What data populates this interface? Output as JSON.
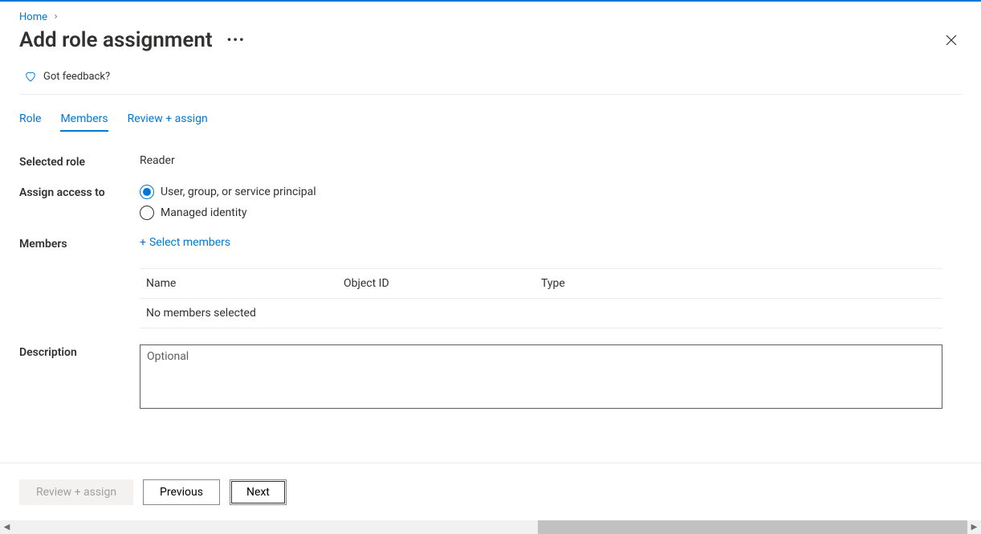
{
  "breadcrumb": {
    "home": "Home"
  },
  "page": {
    "title": "Add role assignment"
  },
  "feedback": {
    "label": "Got feedback?"
  },
  "tabs": {
    "role": "Role",
    "members": "Members",
    "review": "Review + assign"
  },
  "fields": {
    "selected_role_label": "Selected role",
    "selected_role_value": "Reader",
    "assign_access_label": "Assign access to",
    "assign_option_user": "User, group, or service principal",
    "assign_option_mi": "Managed identity",
    "members_label": "Members",
    "select_members_label": "Select members",
    "description_label": "Description",
    "description_placeholder": "Optional"
  },
  "members_table": {
    "header_name": "Name",
    "header_oid": "Object ID",
    "header_type": "Type",
    "empty_text": "No members selected"
  },
  "footer": {
    "review": "Review + assign",
    "previous": "Previous",
    "next": "Next"
  }
}
